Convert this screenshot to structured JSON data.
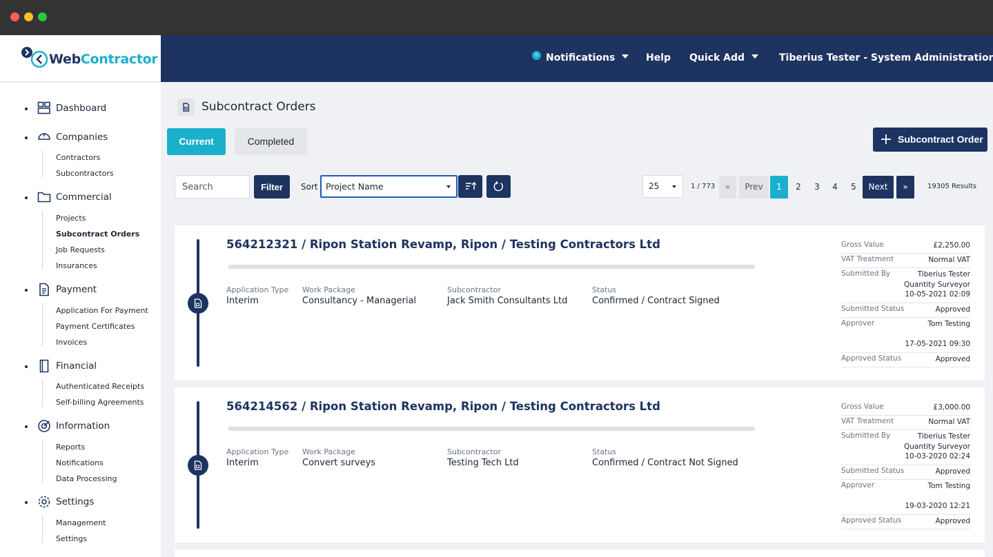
{
  "brand": {
    "name_part1": "Web",
    "name_part2": "Contractor"
  },
  "topnav": {
    "notifications_label": "Notifications",
    "notifications_count": "0",
    "help_label": "Help",
    "quick_add_label": "Quick Add",
    "user_label": "Tiberius Tester - System Administration"
  },
  "sidebar": {
    "dashboard": "Dashboard",
    "companies": "Companies",
    "companies_items": [
      "Contractors",
      "Subcontractors"
    ],
    "commercial": "Commercial",
    "commercial_items": [
      "Projects",
      "Subcontract Orders",
      "Job Requests",
      "Insurances"
    ],
    "payment": "Payment",
    "payment_items": [
      "Application For Payment",
      "Payment Certificates",
      "Invoices"
    ],
    "financial": "Financial",
    "financial_items": [
      "Authenticated Receipts",
      "Self-billing Agreements"
    ],
    "information": "Information",
    "information_items": [
      "Reports",
      "Notifications",
      "Data Processing"
    ],
    "settings": "Settings",
    "settings_items": [
      "Management",
      "Settings"
    ]
  },
  "page": {
    "title": "Subcontract Orders",
    "tab_current": "Current",
    "tab_completed": "Completed",
    "new_button": "Subcontract Order"
  },
  "toolbar": {
    "search_placeholder": "Search",
    "filter_label": "Filter",
    "sort_label": "Sort",
    "sort_value": "Project Name",
    "page_size": "25",
    "page_count": "1 / 773",
    "first": "«",
    "prev": "Prev",
    "pages": [
      "1",
      "2",
      "3",
      "4",
      "5"
    ],
    "current_page": "1",
    "next": "Next",
    "last": "»",
    "results": "19305 Results"
  },
  "orders": [
    {
      "number": "564212321",
      "title_rest": " / Ripon Station Revamp, Ripon / Testing Contractors Ltd",
      "labels": {
        "application_type": "Application Type",
        "work_package": "Work Package",
        "subcontractor": "Subcontractor",
        "status": "Status"
      },
      "application_type": "Interim",
      "work_package": "Consultancy - Managerial",
      "subcontractor": "Jack Smith Consultants Ltd",
      "status": "Confirmed / Contract Signed",
      "meta": {
        "gross_value_label": "Gross Value",
        "gross_value": "£2,250.00",
        "vat_label": "VAT Treatment",
        "vat": "Normal VAT",
        "submitted_by_label": "Submitted By",
        "submitted_by_name": "Tiberius Tester",
        "submitted_by_role": "Quantity Surveyor",
        "submitted_at": "10-05-2021 02:09",
        "submitted_status_label": "Submitted Status",
        "submitted_status": "Approved",
        "approver_label": "Approver",
        "approver": "Tom Testing",
        "approved_at": "17-05-2021 09:30",
        "approved_status_label": "Approved Status",
        "approved_status": "Approved"
      }
    },
    {
      "number": "564214562",
      "title_rest": " / Ripon Station Revamp, Ripon / Testing Contractors Ltd",
      "labels": {
        "application_type": "Application Type",
        "work_package": "Work Package",
        "subcontractor": "Subcontractor",
        "status": "Status"
      },
      "application_type": "Interim",
      "work_package": "Convert surveys",
      "subcontractor": "Testing Tech Ltd",
      "status": "Confirmed / Contract Not Signed",
      "meta": {
        "gross_value_label": "Gross Value",
        "gross_value": "£3,000.00",
        "vat_label": "VAT Treatment",
        "vat": "Normal VAT",
        "submitted_by_label": "Submitted By",
        "submitted_by_name": "Tiberius Tester",
        "submitted_by_role": "Quantity Surveyor",
        "submitted_at": "10-03-2020 02:24",
        "submitted_status_label": "Submitted Status",
        "submitted_status": "Approved",
        "approver_label": "Approver",
        "approver": "Tom Testing",
        "approved_at": "19-03-2020 12:21",
        "approved_status_label": "Approved Status",
        "approved_status": "Approved"
      }
    }
  ],
  "colors": {
    "navy": "#1d3461",
    "accent": "#1ab0cc",
    "background": "#f0f1f4"
  }
}
